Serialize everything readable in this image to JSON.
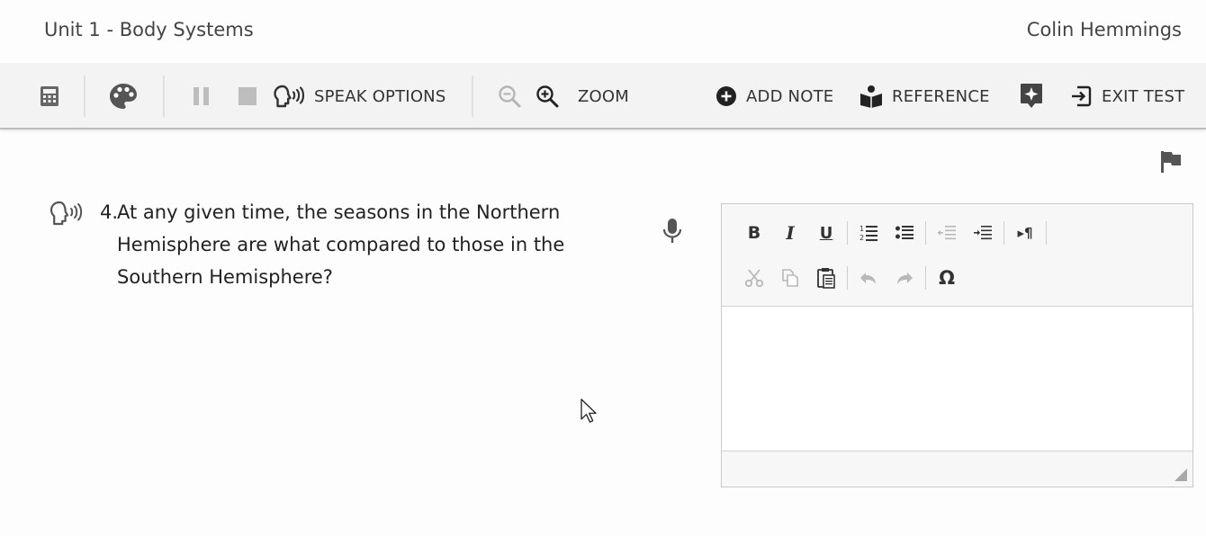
{
  "header": {
    "unit_title": "Unit 1 - Body Systems",
    "user_name": "Colin Hemmings"
  },
  "toolbar": {
    "calculator_icon": "calculator-icon",
    "palette_icon": "palette-icon",
    "pause_icon": "pause-icon",
    "stop_icon": "stop-icon",
    "speak_options_label": "SPEAK OPTIONS",
    "zoom_out_icon": "zoom-out-icon",
    "zoom_in_icon": "zoom-in-icon",
    "zoom_label": "ZOOM",
    "add_note_label": "ADD NOTE",
    "reference_label": "REFERENCE",
    "spark_icon": "spark-icon",
    "exit_test_label": "EXIT TEST"
  },
  "question": {
    "number": "4.",
    "text": "At any given time, the seasons in the Northern Hemisphere are what compared to those in the Southern Hemisphere?"
  },
  "editor": {
    "row1": [
      "bold-icon",
      "italic-icon",
      "underline-icon",
      "numbered-list-icon",
      "bulleted-list-icon",
      "outdent-icon",
      "indent-icon",
      "paragraph-direction-icon"
    ],
    "row2": [
      "cut-icon",
      "copy-icon",
      "paste-icon",
      "undo-icon",
      "redo-icon",
      "special-character-icon"
    ],
    "value": ""
  },
  "colors": {
    "toolbar_bg": "#f3f3f3",
    "text": "#333333",
    "disabled_icon": "#b8b8b8",
    "icon": "#333333"
  }
}
